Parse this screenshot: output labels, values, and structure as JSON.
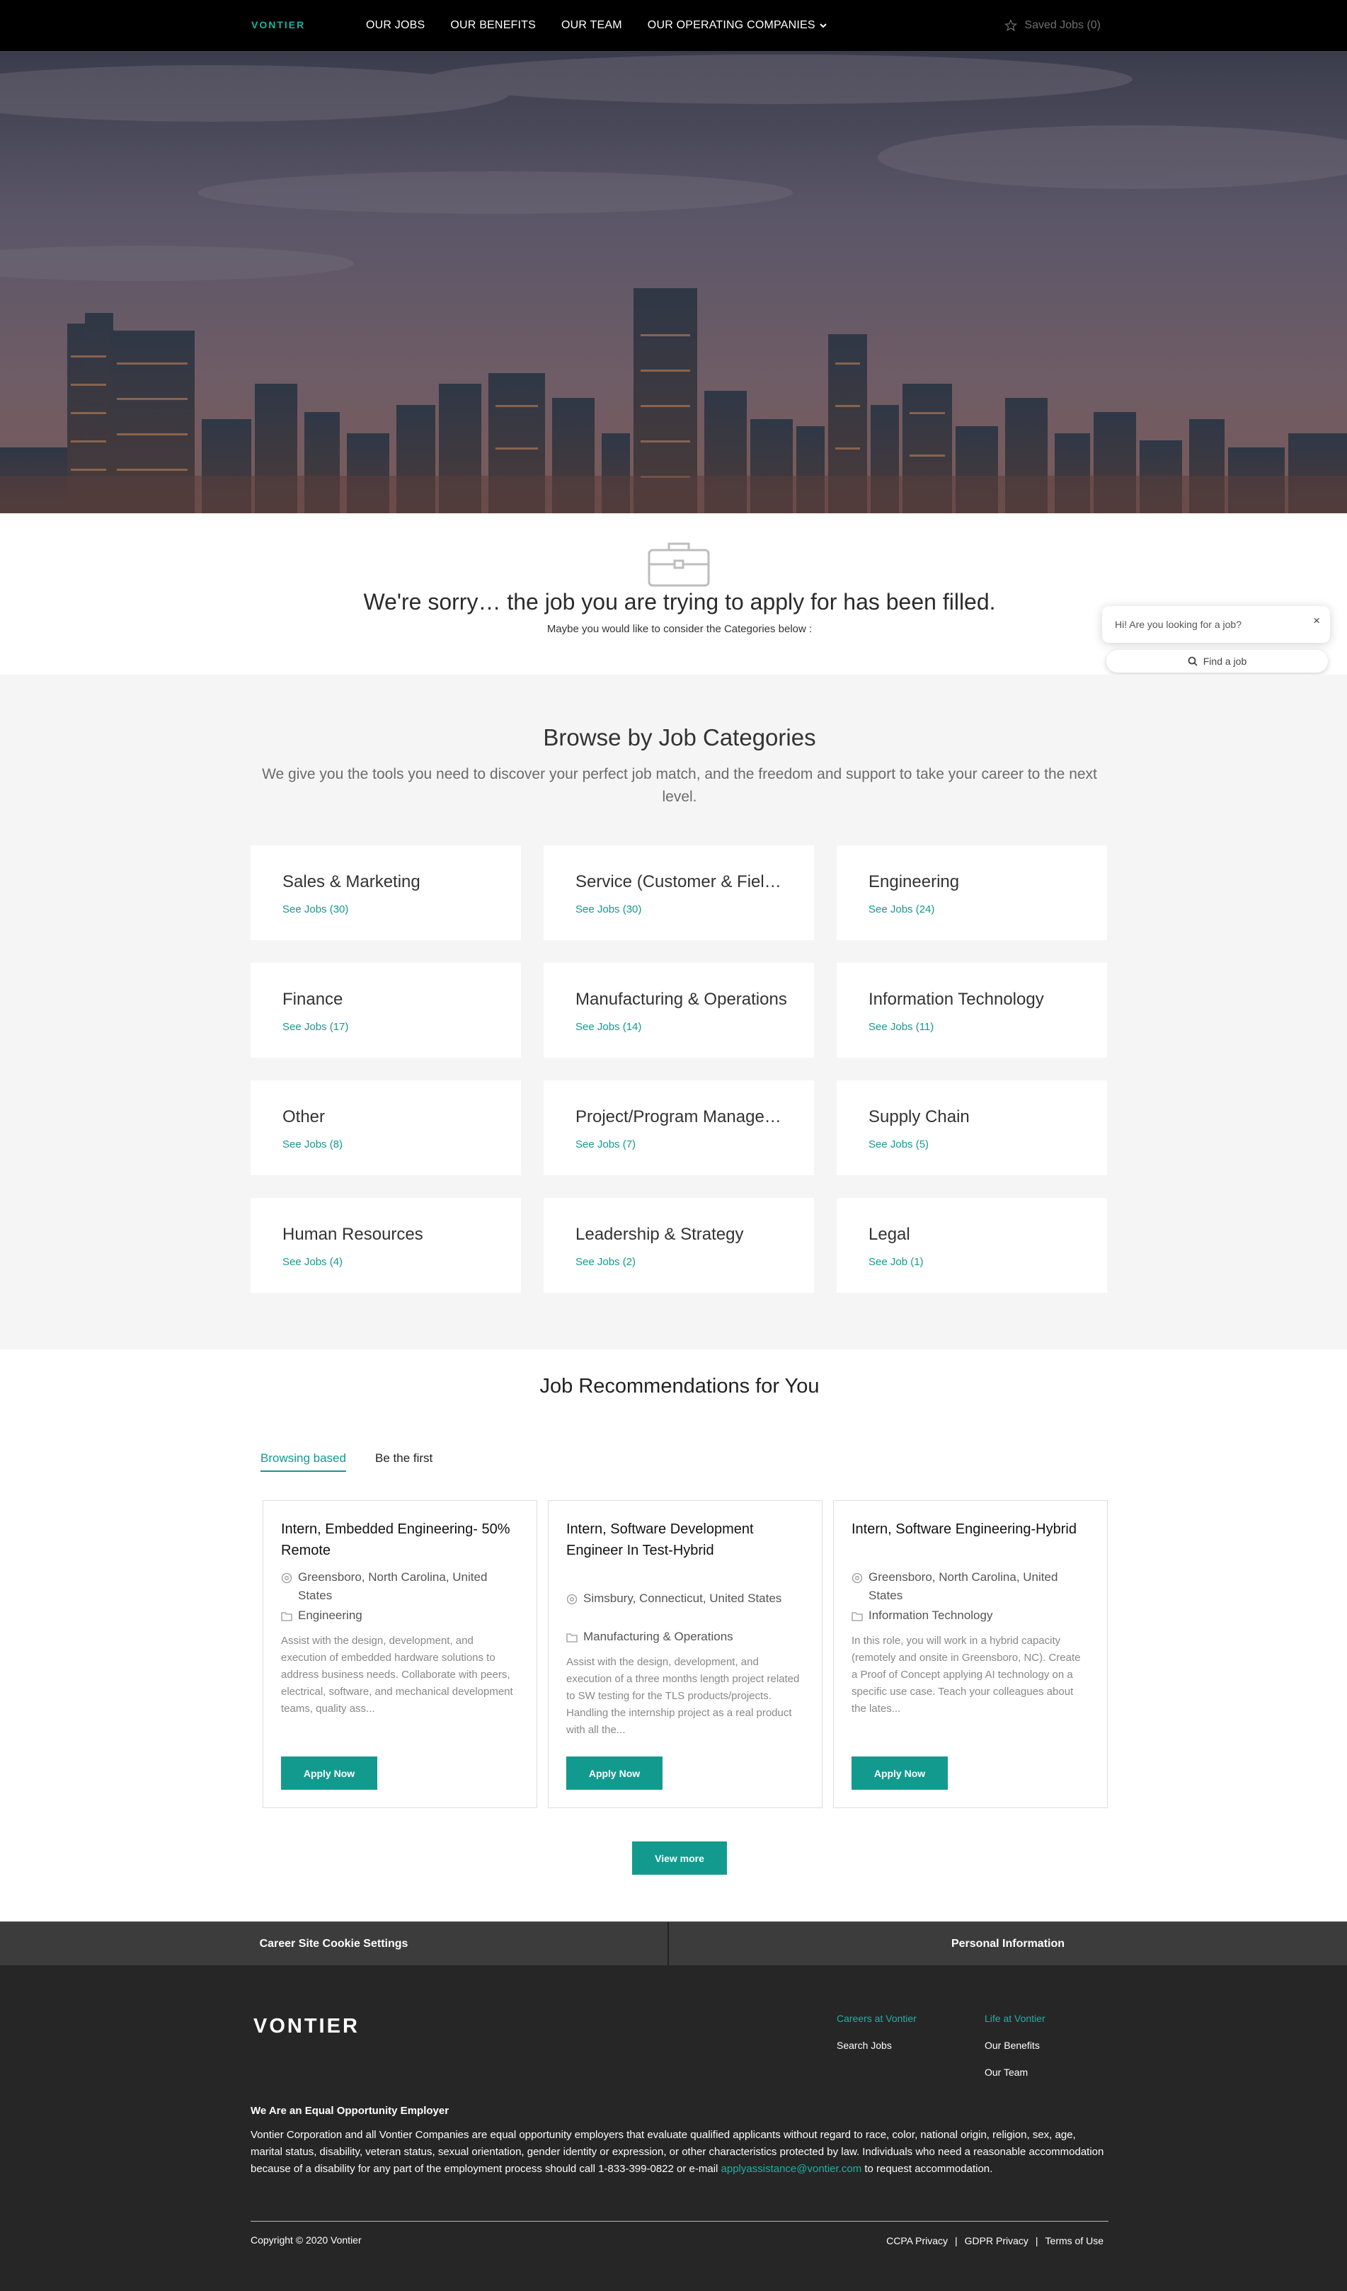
{
  "header": {
    "logo_text": "VONTIER",
    "nav": [
      "OUR JOBS",
      "OUR BENEFITS",
      "OUR TEAM",
      "OUR OPERATING COMPANIES"
    ],
    "saved_jobs": "Saved Jobs (0)"
  },
  "notice": {
    "title": "We're sorry… the job you are trying to apply for has been filled.",
    "subtitle": "Maybe you would like to consider the Categories below :"
  },
  "chat": {
    "greeting": "Hi! Are you looking for a job?",
    "close": "×",
    "find_label": "Find a job"
  },
  "browse": {
    "title": "Browse by Job Categories",
    "lead": "We give you the tools you need to discover your perfect job match, and the freedom and support to take your career to the next level.",
    "categories": [
      {
        "title": "Sales & Marketing",
        "link": "See Jobs (30)"
      },
      {
        "title": "Service (Customer & Field Service)",
        "link": "See Jobs (30)"
      },
      {
        "title": "Engineering",
        "link": "See Jobs (24)"
      },
      {
        "title": "Finance",
        "link": "See Jobs (17)"
      },
      {
        "title": "Manufacturing & Operations",
        "link": "See Jobs (14)"
      },
      {
        "title": "Information Technology",
        "link": "See Jobs (11)"
      },
      {
        "title": "Other",
        "link": "See Jobs (8)"
      },
      {
        "title": "Project/Program Management",
        "link": "See Jobs (7)"
      },
      {
        "title": "Supply Chain",
        "link": "See Jobs (5)"
      },
      {
        "title": "Human Resources",
        "link": "See Jobs (4)"
      },
      {
        "title": "Leadership & Strategy",
        "link": "See Jobs (2)"
      },
      {
        "title": "Legal",
        "link": "See Job (1)"
      }
    ]
  },
  "recommendations": {
    "title": "Job Recommendations for You",
    "tabs": [
      "Browsing based",
      "Be the first"
    ],
    "jobs": [
      {
        "title": "Intern, Embedded Engineering- 50% Remote",
        "location": "Greensboro, North Carolina, United States",
        "category": "Engineering",
        "description": "Assist with the design, development, and execution of embedded hardware solutions to address business needs. Collaborate with peers, electrical, software, and mechanical development teams, quality ass...",
        "apply": "Apply Now"
      },
      {
        "title": "Intern, Software Development Engineer In Test-Hybrid",
        "location": "Simsbury, Connecticut, United States",
        "category": "Manufacturing & Operations",
        "description": "Assist with the design, development, and execution of a three months length project related to SW testing for the TLS products/projects. Handling the internship project as a real product with all the...",
        "apply": "Apply Now"
      },
      {
        "title": "Intern, Software Engineering-Hybrid",
        "location": "Greensboro, North Carolina, United States",
        "category": "Information Technology",
        "description": "In this role, you will work in a hybrid capacity (remotely and onsite in Greensboro, NC). Create a Proof of Concept applying AI technology on a specific use case. Teach your colleagues about the lates...",
        "apply": "Apply Now"
      }
    ],
    "view_more": "View more"
  },
  "footer": {
    "cookie_settings": "Career Site Cookie Settings",
    "personal_info": "Personal Information",
    "logo_text": "VONTIER",
    "col1": {
      "head": "Careers at Vontier",
      "links": [
        "Search Jobs"
      ]
    },
    "col2": {
      "head": "Life at Vontier",
      "links": [
        "Our Benefits",
        "Our Team"
      ]
    },
    "eoe_title": "We Are an Equal Opportunity Employer",
    "eoe_text": "Vontier Corporation and all Vontier Companies are equal opportunity employers that evaluate qualified applicants without regard to race, color, national origin, religion, sex, age, marital status, disability, veteran status, sexual orientation, gender identity or expression, or other characteristics protected by law. Individuals who need a reasonable accommodation because of a disability for any part of the employment process should call 1-833-399-0822 or e-mail",
    "eoe_email": "applyassistance@vontier.com",
    "eoe_tail": "to request accommodation.",
    "copyright": "Copyright © 2020 Vontier",
    "legal_links": [
      "CCPA Privacy",
      "GDPR Privacy",
      "Terms of Use"
    ]
  },
  "colors": {
    "accent": "#139a8e",
    "footer_bg": "#262626",
    "header_bg": "#000000"
  }
}
